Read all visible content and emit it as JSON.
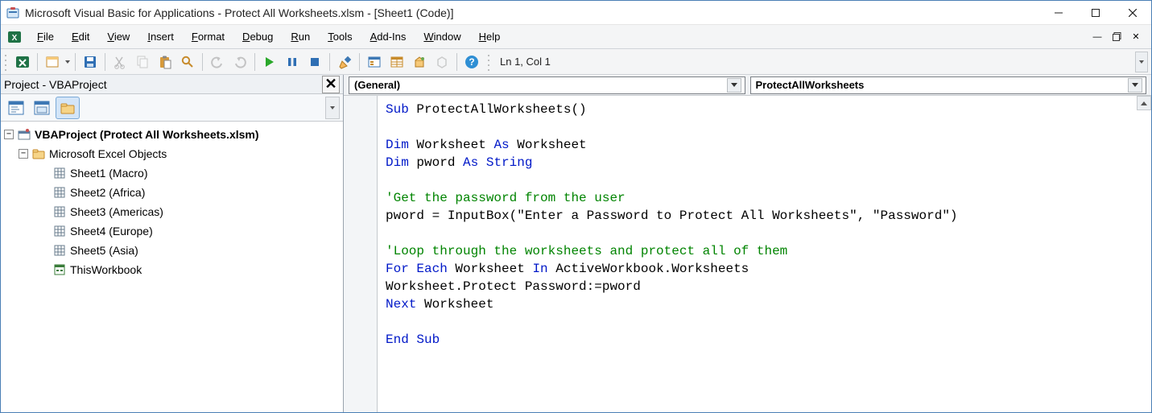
{
  "titlebar": {
    "title": "Microsoft Visual Basic for Applications - Protect All Worksheets.xlsm - [Sheet1 (Code)]"
  },
  "menu": {
    "items": [
      "File",
      "Edit",
      "View",
      "Insert",
      "Format",
      "Debug",
      "Run",
      "Tools",
      "Add-Ins",
      "Window",
      "Help"
    ]
  },
  "toolbar": {
    "status": "Ln 1, Col 1"
  },
  "project": {
    "pane_title": "Project - VBAProject",
    "root": "VBAProject (Protect All Worksheets.xlsm)",
    "folder": "Microsoft Excel Objects",
    "items": [
      "Sheet1 (Macro)",
      "Sheet2 (Africa)",
      "Sheet3 (Americas)",
      "Sheet4 (Europe)",
      "Sheet5 (Asia)",
      "ThisWorkbook"
    ]
  },
  "code_dropdowns": {
    "left": "(General)",
    "right": "ProtectAllWorksheets"
  },
  "code_lines": [
    {
      "t": "kw",
      "s": "Sub"
    },
    {
      "t": "tx",
      "s": " ProtectAllWorksheets()"
    },
    {
      "br": 1
    },
    {
      "br": 1
    },
    {
      "t": "kw",
      "s": "Dim"
    },
    {
      "t": "tx",
      "s": " Worksheet "
    },
    {
      "t": "kw",
      "s": "As"
    },
    {
      "t": "tx",
      "s": " Worksheet"
    },
    {
      "br": 1
    },
    {
      "t": "kw",
      "s": "Dim"
    },
    {
      "t": "tx",
      "s": " pword "
    },
    {
      "t": "kw",
      "s": "As"
    },
    {
      "t": "tx",
      "s": " "
    },
    {
      "t": "kw",
      "s": "String"
    },
    {
      "br": 1
    },
    {
      "br": 1
    },
    {
      "t": "cm",
      "s": "'Get the password from the user"
    },
    {
      "br": 1
    },
    {
      "t": "tx",
      "s": "pword = InputBox(\"Enter a Password to Protect All Worksheets\", \"Password\")"
    },
    {
      "br": 1
    },
    {
      "br": 1
    },
    {
      "t": "cm",
      "s": "'Loop through the worksheets and protect all of them"
    },
    {
      "br": 1
    },
    {
      "t": "kw",
      "s": "For Each"
    },
    {
      "t": "tx",
      "s": " Worksheet "
    },
    {
      "t": "kw",
      "s": "In"
    },
    {
      "t": "tx",
      "s": " ActiveWorkbook.Worksheets"
    },
    {
      "br": 1
    },
    {
      "t": "tx",
      "s": "Worksheet.Protect Password:=pword"
    },
    {
      "br": 1
    },
    {
      "t": "kw",
      "s": "Next"
    },
    {
      "t": "tx",
      "s": " Worksheet"
    },
    {
      "br": 1
    },
    {
      "br": 1
    },
    {
      "t": "kw",
      "s": "End Sub"
    }
  ]
}
